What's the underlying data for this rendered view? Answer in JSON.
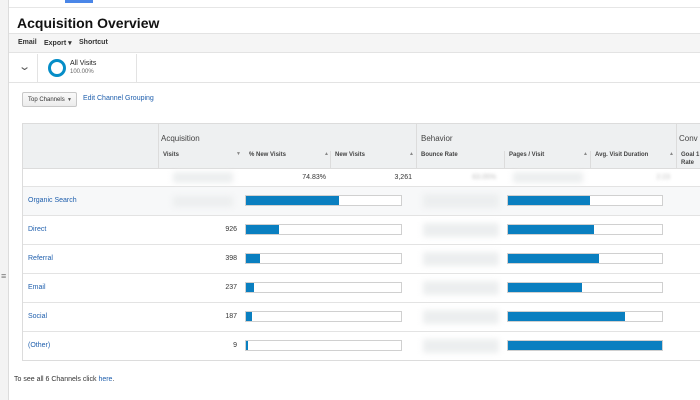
{
  "page": {
    "title": "Acquisition Overview"
  },
  "toolbar": {
    "email": "Email",
    "export": "Export ▾",
    "shortcut": "Shortcut"
  },
  "segment": {
    "name": "All Visits",
    "pct": "100.00%",
    "ring_color": "#058dc7"
  },
  "grouping": {
    "select_value": "Top Channels",
    "edit_link": "Edit Channel Grouping"
  },
  "table": {
    "groups": {
      "acquisition": "Acquisition",
      "behavior": "Behavior",
      "conversions": "Conv"
    },
    "columns": {
      "visits": "Visits",
      "new_visits_pct": "% New Visits",
      "new_visits": "New Visits",
      "bounce_rate": "Bounce Rate",
      "pages_visit": "Pages / Visit",
      "avg_duration": "Avg. Visit Duration",
      "goal_line1": "Goal 1",
      "goal_line2": "Rate"
    },
    "totals": {
      "new_visits_pct": "74.83%",
      "new_visits": "3,261",
      "bounce_rate": "63.05%",
      "avg_duration": "2:23"
    },
    "rows": [
      {
        "channel": "Organic Search",
        "visits": "",
        "new_pct_fill": 0.6,
        "pages_fill": 0.53
      },
      {
        "channel": "Direct",
        "visits": "926",
        "new_pct_fill": 0.21,
        "pages_fill": 0.56
      },
      {
        "channel": "Referral",
        "visits": "398",
        "new_pct_fill": 0.09,
        "pages_fill": 0.59
      },
      {
        "channel": "Email",
        "visits": "237",
        "new_pct_fill": 0.05,
        "pages_fill": 0.48
      },
      {
        "channel": "Social",
        "visits": "187",
        "new_pct_fill": 0.04,
        "pages_fill": 0.76
      },
      {
        "channel": "(Other)",
        "visits": "9",
        "new_pct_fill": 0.01,
        "pages_fill": 1.0
      }
    ],
    "bar_color": "#0a7fc0"
  },
  "footer": {
    "prefix": "To see all 6 Channels click ",
    "link": "here",
    "suffix": "."
  }
}
